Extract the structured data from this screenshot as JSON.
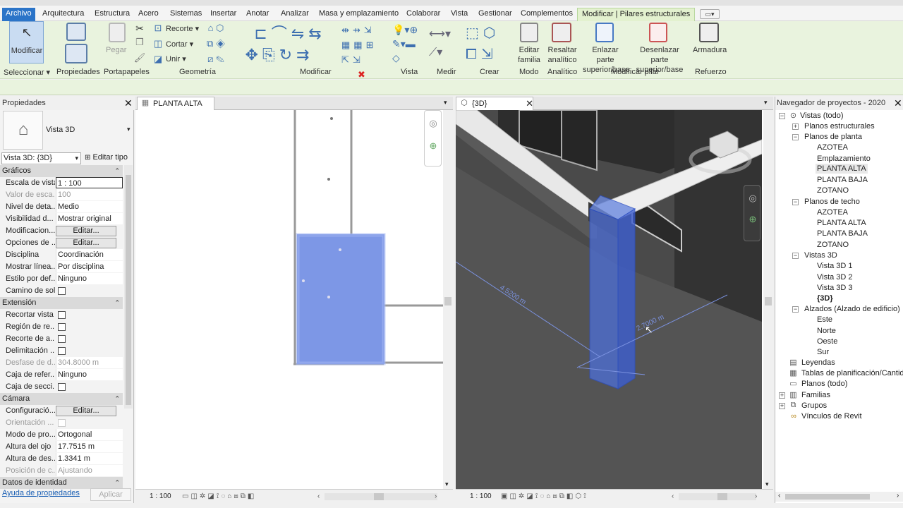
{
  "menu": {
    "tabs": [
      "Archivo",
      "Arquitectura",
      "Estructura",
      "Acero",
      "Sistemas",
      "Insertar",
      "Anotar",
      "Analizar",
      "Masa y emplazamiento",
      "Colaborar",
      "Vista",
      "Gestionar",
      "Complementos",
      "Modificar | Pilares estructurales"
    ]
  },
  "ribbon": {
    "modify_label": "Modificar",
    "paste_label": "Pegar",
    "cut_label": "Recorte",
    "cope_label": "Cortar",
    "join_label": "Unir",
    "edit_family_label": "Editar familia",
    "highlight_analytical_label": "Resaltar analítico",
    "attach_label": "Enlazar parte superior/base",
    "detach_label": "Desenlazar parte superior/base",
    "rebar_label": "Armadura",
    "panels": {
      "select": "Seleccionar",
      "properties": "Propiedades",
      "clipboard": "Portapapeles",
      "geometry": "Geometría",
      "modify": "Modificar",
      "view": "Vista",
      "measure": "Medir",
      "create": "Crear",
      "mode": "Modo",
      "analytical": "Analítico",
      "modify_column": "Modificar pilar",
      "reinforcement": "Refuerzo"
    }
  },
  "properties": {
    "title": "Propiedades",
    "type_name": "Vista 3D",
    "instance_selector": "Vista 3D: {3D}",
    "edit_type": "Editar tipo",
    "help_link": "Ayuda de propiedades",
    "apply": "Aplicar",
    "sections": {
      "graphics": "Gráficos",
      "extents": "Extensión",
      "camera": "Cámara",
      "identity": "Datos de identidad"
    },
    "rows": {
      "scale_k": "Escala de vista",
      "scale_v": "1 : 100",
      "scaleval_k": "Valor de esca...",
      "scaleval_v": "100",
      "detail_k": "Nivel de deta...",
      "detail_v": "Medio",
      "visibility_k": "Visibilidad d...",
      "visibility_v": "Mostrar original",
      "vgo_k": "Modificacion...",
      "vgo_v": "Editar...",
      "display_k": "Opciones de ...",
      "display_v": "Editar...",
      "discipline_k": "Disciplina",
      "discipline_v": "Coordinación",
      "showhidden_k": "Mostrar línea...",
      "showhidden_v": "Por disciplina",
      "defstyle_k": "Estilo por def...",
      "defstyle_v": "Ninguno",
      "sunpath_k": "Camino de sol",
      "crop_k": "Recortar vista",
      "cropreg_k": "Región de re...",
      "annocrop_k": "Recorte de a...",
      "farclip_k": "Delimitación ...",
      "faroffset_k": "Desfase de d...",
      "faroffset_v": "304.8000 m",
      "scopebox_k": "Caja de refer...",
      "scopebox_v": "Ninguno",
      "sectionbox_k": "Caja de secci...",
      "render_k": "Configuració...",
      "render_v": "Editar...",
      "orient_k": "Orientación ...",
      "projmode_k": "Modo de pro...",
      "projmode_v": "Ortogonal",
      "eye_k": "Altura del ojo",
      "eye_v": "17.7515 m",
      "target_k": "Altura de des...",
      "target_v": "1.3341 m",
      "campos_k": "Posición de c...",
      "campos_v": "Ajustando"
    }
  },
  "plan_view": {
    "tab": "PLANTA ALTA",
    "scale": "1 : 100"
  },
  "view_3d": {
    "tab": "{3D}",
    "scale": "1 : 100",
    "dim1": "4.5200 m",
    "dim2": "2.7000 m"
  },
  "navigator": {
    "title": "Navegador de proyectos - 2020",
    "tree": {
      "views_all": "Vistas (todo)",
      "struct_plans": "Planos estructurales",
      "floor_plans": "Planos de planta",
      "fp": [
        "AZOTEA",
        "Emplazamiento",
        "PLANTA ALTA",
        "PLANTA BAJA",
        "ZOTANO"
      ],
      "ceiling_plans": "Planos de techo",
      "cp": [
        "AZOTEA",
        "PLANTA ALTA",
        "PLANTA BAJA",
        "ZOTANO"
      ],
      "views3d": "Vistas 3D",
      "v3": [
        "Vista 3D 1",
        "Vista 3D 2",
        "Vista 3D 3",
        "{3D}"
      ],
      "elevations": "Alzados (Alzado de edificio)",
      "el": [
        "Este",
        "Norte",
        "Oeste",
        "Sur"
      ],
      "legends": "Leyendas",
      "schedules": "Tablas de planificación/Cantidades",
      "sheets": "Planos (todo)",
      "families": "Familias",
      "groups": "Grupos",
      "links": "Vínculos de Revit"
    }
  },
  "colors": {
    "accent": "#2b74c8",
    "ribbon_bg": "#e9f3de",
    "selection_blue": "#5a7fe0"
  }
}
